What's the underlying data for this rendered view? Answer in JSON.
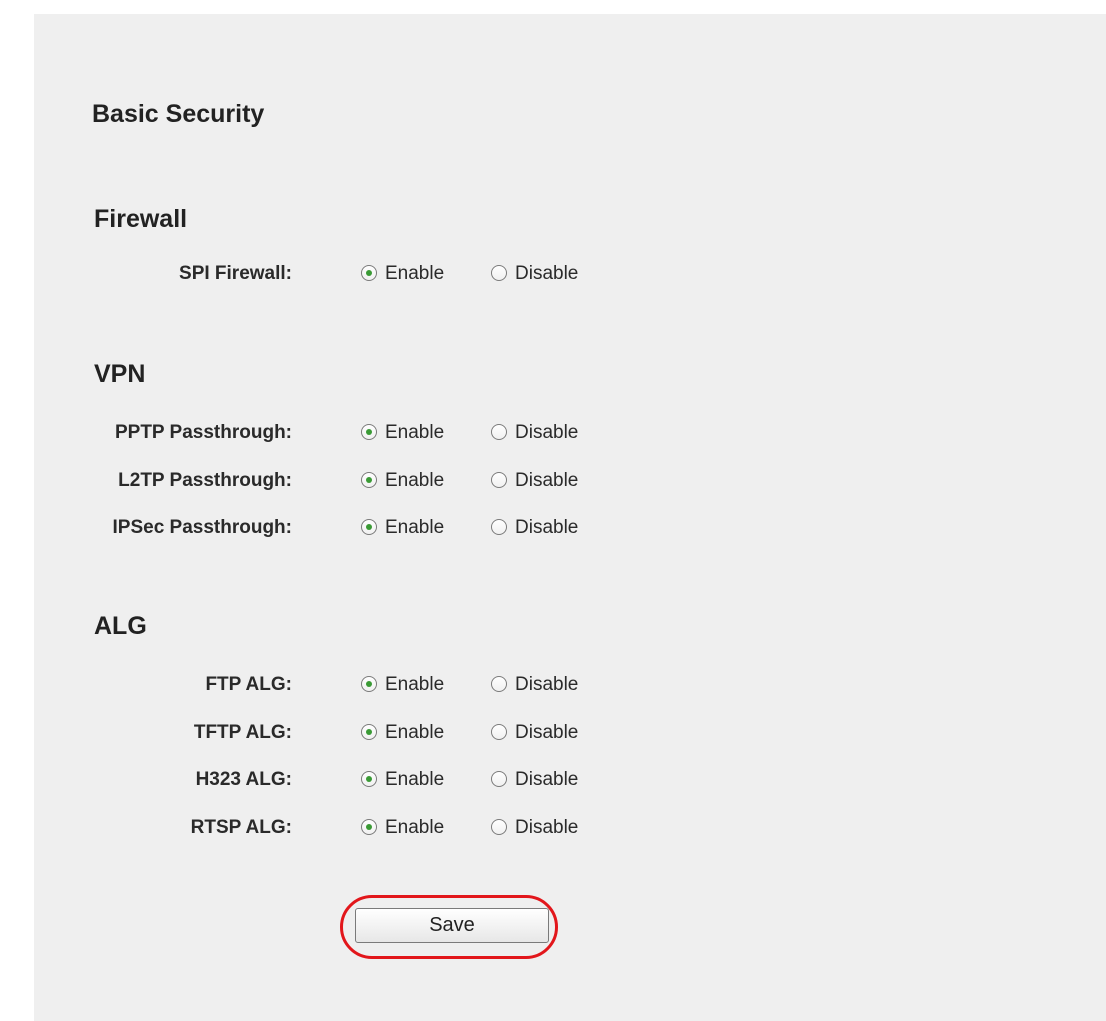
{
  "page_title": "Basic Security",
  "sections": [
    {
      "title": "Firewall",
      "rows": [
        {
          "label": "SPI Firewall:",
          "value": "Enable"
        }
      ]
    },
    {
      "title": "VPN",
      "rows": [
        {
          "label": "PPTP Passthrough:",
          "value": "Enable"
        },
        {
          "label": "L2TP Passthrough:",
          "value": "Enable"
        },
        {
          "label": "IPSec Passthrough:",
          "value": "Enable"
        }
      ]
    },
    {
      "title": "ALG",
      "rows": [
        {
          "label": "FTP ALG:",
          "value": "Enable"
        },
        {
          "label": "TFTP ALG:",
          "value": "Enable"
        },
        {
          "label": "H323 ALG:",
          "value": "Enable"
        },
        {
          "label": "RTSP ALG:",
          "value": "Enable"
        }
      ]
    }
  ],
  "options": {
    "enable": "Enable",
    "disable": "Disable"
  },
  "save_label": "Save",
  "colors": {
    "highlight_ring": "#e2161b",
    "radio_dot": "#3a9a35",
    "panel_bg": "#efefef"
  }
}
